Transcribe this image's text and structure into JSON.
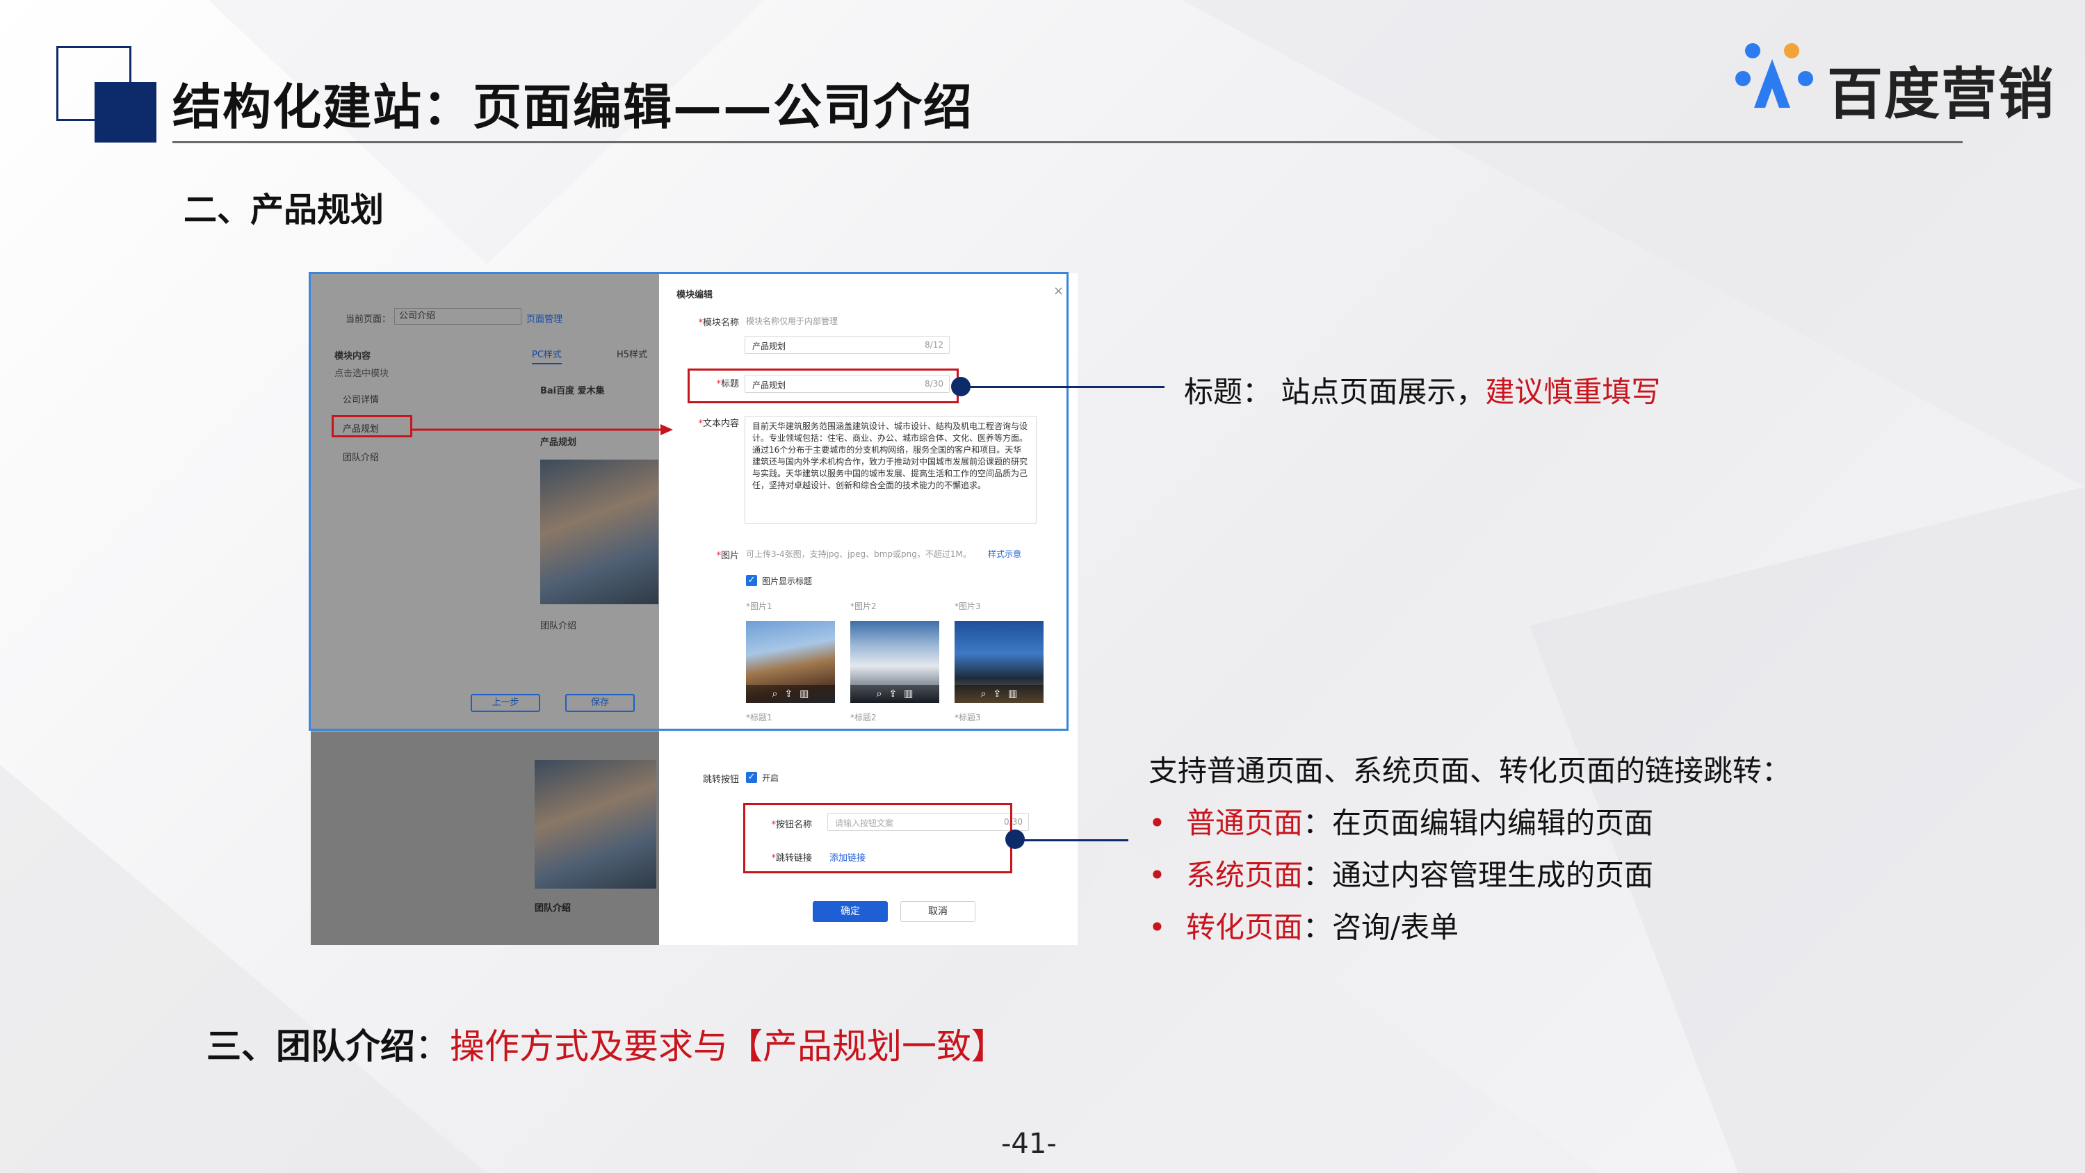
{
  "header": {
    "title": "结构化建站：页面编辑——公司介绍",
    "logo_text": "百度营销"
  },
  "section2": {
    "title": "二、产品规划"
  },
  "section3": {
    "prefix": "三、团队介绍",
    "sep": "：",
    "note": "操作方式及要求与【产品规划一致】"
  },
  "page_number": "-41-",
  "colors": {
    "navy": "#0d2a6b",
    "accent_red": "#c8141c",
    "primary_blue": "#1f5fd6"
  },
  "screenshot": {
    "left_pane": {
      "current_page_label": "当前页面：",
      "current_page_value": "公司介绍",
      "page_manage_link": "页面管理",
      "module_content": "模块内容",
      "module_hint": "点击选中模块",
      "tab_pc": "PC样式",
      "tab_h5": "H5样式",
      "modules": [
        "公司详情",
        "产品规划",
        "团队介绍"
      ],
      "preview_brand": "Bai百度 爱木集",
      "preview_heading_1": "产品规划",
      "preview_heading_2": "团队介绍",
      "preview_heading_3": "团队介绍",
      "btn_prev": "上一步",
      "btn_save": "保存"
    },
    "dialog": {
      "title": "模块编辑",
      "close_icon": "×",
      "module_name_label": "模块名称",
      "module_name_hint": "模块名称仅用于内部管理",
      "module_name_value": "产品规划",
      "module_name_count": "8/12",
      "title_label": "标题",
      "title_value": "产品规划",
      "title_count": "8/30",
      "text_label": "文本内容",
      "text_value": "目前天华建筑服务范围涵盖建筑设计、城市设计、结构及机电工程咨询与设计。专业领域包括：住宅、商业、办公、城市综合体、文化、医养等方面。通过16个分布于主要城市的分支机构网络，服务全国的客户和项目。天华建筑还与国内外学术机构合作，致力于推动对中国城市发展前沿课题的研究与实践。天华建筑以服务中国的城市发展、提高生活和工作的空间品质为己任，坚持对卓越设计、创新和综合全面的技术能力的不懈追求。",
      "image_label": "图片",
      "image_hint": "可上传3-4张图，支持jpg、jpeg、bmp或png，不超过1M。",
      "image_style_link": "样式示意",
      "show_image_title": "图片显示标题",
      "images": [
        {
          "label": "*图片1",
          "title": "*标题1"
        },
        {
          "label": "*图片2",
          "title": "*标题2"
        },
        {
          "label": "*图片3",
          "title": "*标题3"
        }
      ],
      "jump_label": "跳转按钮",
      "jump_toggle": "开启",
      "btn_name_label": "按钮名称",
      "btn_name_placeholder": "请输入按钮文案",
      "btn_name_count": "0/30",
      "jump_link_label": "跳转链接",
      "add_link": "添加链接",
      "ok": "确定",
      "cancel": "取消"
    }
  },
  "annotations": {
    "title_note_prefix": "标题：  站点页面展示，",
    "title_note_red": "建议慎重填写",
    "link_intro": "支持普通页面、系统页面、转化页面的链接跳转：",
    "bullets": [
      {
        "term": "普通页面",
        "desc": "：在页面编辑内编辑的页面"
      },
      {
        "term": "系统页面",
        "desc": "：通过内容管理生成的页面"
      },
      {
        "term": "转化页面",
        "desc": "：咨询/表单"
      }
    ],
    "bullet_mark": "•"
  }
}
